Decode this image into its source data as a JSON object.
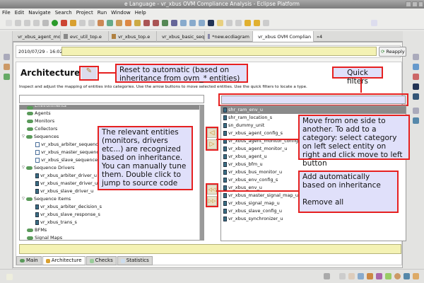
{
  "window": {
    "title": "e Language - vr_xbus OVM Compliance Analysis - Eclipse Platform"
  },
  "menu": [
    "File",
    "Edit",
    "Navigate",
    "Search",
    "Project",
    "Run",
    "Window",
    "Help"
  ],
  "editor_tabs": [
    {
      "label": "vr_xbus_agent_monito"
    },
    {
      "label": "evc_util_top.e"
    },
    {
      "label": "vr_xbus_top.e"
    },
    {
      "label": "vr_xbus_basic_seq_li"
    },
    {
      "label": "*new.ecdiagram"
    },
    {
      "label": "vr_xbus OVM Complian",
      "active": true
    }
  ],
  "overflow_tabs": "»4",
  "header": {
    "timestamp": "2010/07/29 - 16:02",
    "status_value": "",
    "reapply_label": "Reapply"
  },
  "section": {
    "title": "Architecture",
    "description": "Inspect and adjust the mapping of entities into categories. Use the arrow buttons to move selected entities. Use the quick filters to locate a type."
  },
  "left_filter": {
    "value": ""
  },
  "right_filter": {
    "value": ""
  },
  "category_tree": [
    {
      "label": "Environments",
      "kind": "ovm",
      "level": 0,
      "selected": true
    },
    {
      "label": "Agents",
      "kind": "ovm",
      "level": 0
    },
    {
      "label": "Monitors",
      "kind": "ovm",
      "level": 0
    },
    {
      "label": "Collectors",
      "kind": "ovm",
      "level": 0
    },
    {
      "label": "Sequences",
      "kind": "ovm",
      "level": 0,
      "expanded": true
    },
    {
      "label": "vr_xbus_arbiter_sequence",
      "kind": "seq",
      "level": 1
    },
    {
      "label": "vr_xbus_master_sequence",
      "kind": "seq",
      "level": 1
    },
    {
      "label": "vr_xbus_slave_sequence",
      "kind": "seq",
      "level": 1
    },
    {
      "label": "Sequence Drivers",
      "kind": "ovm",
      "level": 0,
      "expanded": true
    },
    {
      "label": "vr_xbus_arbiter_driver_u",
      "kind": "ent",
      "level": 1
    },
    {
      "label": "vr_xbus_master_driver_u",
      "kind": "ent",
      "level": 1
    },
    {
      "label": "vr_xbus_slave_driver_u",
      "kind": "ent",
      "level": 1
    },
    {
      "label": "Sequence Items",
      "kind": "ovm",
      "level": 0,
      "expanded": true
    },
    {
      "label": "vr_xbus_arbiter_decision_s",
      "kind": "ent",
      "level": 1
    },
    {
      "label": "vr_xbus_slave_response_s",
      "kind": "ent",
      "level": 1
    },
    {
      "label": "vr_xbus_trans_s",
      "kind": "ent",
      "level": 1
    },
    {
      "label": "BFMs",
      "kind": "ovm",
      "level": 0
    },
    {
      "label": "Signal Maps",
      "kind": "ovm",
      "level": 0
    }
  ],
  "entity_list": [
    {
      "label": "shr_ram_env_u",
      "selected": true
    },
    {
      "label": "shr_ram_location_s"
    },
    {
      "label": "sn_dummy_unit"
    },
    {
      "label": "vr_xbus_agent_config_s"
    },
    {
      "label": "vr_xbus_agent_monitor_config_s"
    },
    {
      "label": "vr_xbus_agent_monitor_u"
    },
    {
      "label": "vr_xbus_agent_u"
    },
    {
      "label": "vr_xbus_bfm_u"
    },
    {
      "label": "vr_xbus_bus_monitor_u"
    },
    {
      "label": "vr_xbus_env_config_s"
    },
    {
      "label": "vr_xbus_env_u"
    },
    {
      "label": "vr_xbus_master_signal_map_u"
    },
    {
      "label": "vr_xbus_signal_map_u"
    },
    {
      "label": "vr_xbus_slave_config_u"
    },
    {
      "label": "vr_xbus_synchronizer_u"
    }
  ],
  "move_buttons": {
    "move_left": "◁",
    "move_right": "▷",
    "add_auto": "◁◁",
    "remove_all": "▷▷"
  },
  "callouts": {
    "reset": "Reset to automatic (based on inheritance from ovm_* entities)",
    "quick_filters": "Quick filters",
    "relevant": "The relevant entities (monitors, drivers etc...) are recognized based on inheritance. You can manually tune them. Double click to jump to source code",
    "move": "Move from one side to another. To add to a category: select category on left select entity on right and click move to left button",
    "add_line1": "Add automatically based on inheritance",
    "add_line2": "Remove all"
  },
  "bottom_tabs": [
    {
      "label": "Main"
    },
    {
      "label": "Architecture",
      "active": true
    },
    {
      "label": "Checks"
    },
    {
      "label": "Statistics"
    }
  ],
  "colors": {
    "callout_border": "#e62020",
    "callout_fill": "#e0e0fa",
    "status_yellow": "#f4f2b4"
  }
}
